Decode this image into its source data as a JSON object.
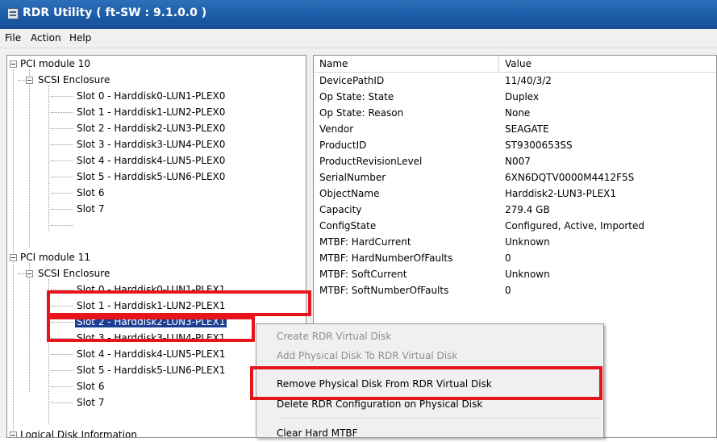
{
  "window": {
    "title": "RDR Utility  ( ft-SW : 9.1.0.0 )"
  },
  "menu": [
    {
      "label": "File"
    },
    {
      "label": "Action"
    },
    {
      "label": "Help"
    }
  ],
  "tree": {
    "rows": [
      {
        "label": "PCI module 10"
      },
      {
        "label": "SCSI Enclosure"
      },
      {
        "label": "Slot 0  -  Harddisk0-LUN1-PLEX0"
      },
      {
        "label": "Slot 1  -  Harddisk1-LUN2-PLEX0"
      },
      {
        "label": "Slot 2  -  Harddisk2-LUN3-PLEX0"
      },
      {
        "label": "Slot 3  -  Harddisk3-LUN4-PLEX0"
      },
      {
        "label": "Slot 4  -  Harddisk4-LUN5-PLEX0"
      },
      {
        "label": "Slot 5  -  Harddisk5-LUN6-PLEX0"
      },
      {
        "label": "Slot 6"
      },
      {
        "label": "Slot 7"
      },
      {
        "label": "PCI module 11"
      },
      {
        "label": "SCSI Enclosure"
      },
      {
        "label": "Slot 0  -  Harddisk0-LUN1-PLEX1"
      },
      {
        "label": "Slot 1  -  Harddisk1-LUN2-PLEX1"
      },
      {
        "label": "Slot 2  -  Harddisk2-LUN3-PLEX1"
      },
      {
        "label": "Slot 3  -  Harddisk3-LUN4-PLEX1"
      },
      {
        "label": "Slot 4  -  Harddisk4-LUN5-PLEX1"
      },
      {
        "label": "Slot 5  -  Harddisk5-LUN6-PLEX1"
      },
      {
        "label": "Slot 6"
      },
      {
        "label": "Slot 7"
      },
      {
        "label": "Logical Disk Information"
      }
    ]
  },
  "properties": {
    "headers": {
      "name": "Name",
      "value": "Value"
    },
    "rows": [
      {
        "name": "DevicePathID",
        "value": "11/40/3/2"
      },
      {
        "name": "Op State: State",
        "value": "Duplex"
      },
      {
        "name": "Op State: Reason",
        "value": "None"
      },
      {
        "name": "Vendor",
        "value": "SEAGATE"
      },
      {
        "name": "ProductID",
        "value": "ST9300653SS"
      },
      {
        "name": "ProductRevisionLevel",
        "value": "N007"
      },
      {
        "name": "SerialNumber",
        "value": "6XN6DQTV0000M4412F5S"
      },
      {
        "name": "ObjectName",
        "value": "Harddisk2-LUN3-PLEX1"
      },
      {
        "name": "Capacity",
        "value": "279.4 GB"
      },
      {
        "name": "ConfigState",
        "value": "Configured, Active, Imported"
      },
      {
        "name": "MTBF: HardCurrent",
        "value": "Unknown"
      },
      {
        "name": "MTBF: HardNumberOfFaults",
        "value": "0"
      },
      {
        "name": "MTBF: SoftCurrent",
        "value": "Unknown"
      },
      {
        "name": "MTBF: SoftNumberOfFaults",
        "value": "0"
      }
    ]
  },
  "context_menu": {
    "items": [
      {
        "label": "Create RDR Virtual Disk",
        "enabled": false
      },
      {
        "label": "Add Physical Disk To RDR Virtual Disk",
        "enabled": false
      },
      {
        "label": "Remove Physical Disk From RDR Virtual Disk",
        "enabled": true
      },
      {
        "label": "Delete RDR Configuration on Physical Disk",
        "enabled": true
      },
      {
        "label": "Clear Hard MTBF",
        "enabled": true
      }
    ]
  },
  "colors": {
    "highlight": "#e8141b",
    "selection": "#1c3f94",
    "titlebar": "#1b5aa6"
  }
}
